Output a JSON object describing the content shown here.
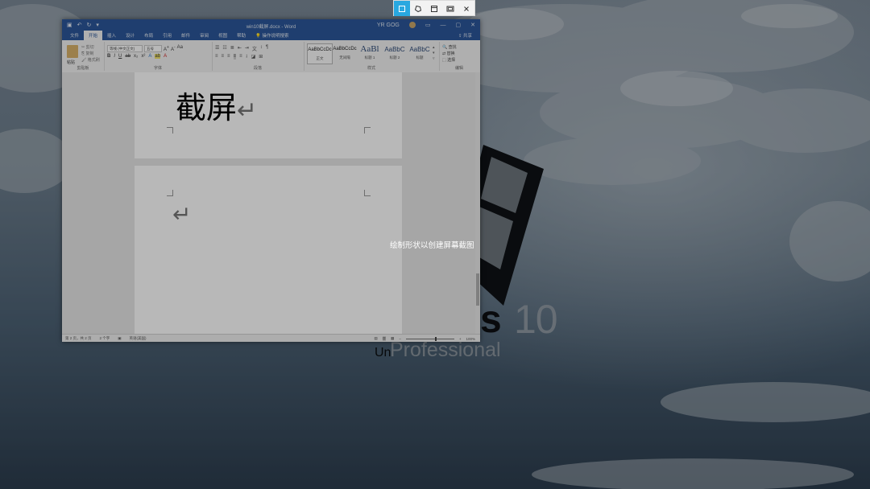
{
  "snip_toolbar": {
    "buttons": [
      {
        "name": "rectangular-snip",
        "icon": "rectangle-snip-icon",
        "active": true
      },
      {
        "name": "freeform-snip",
        "icon": "freeform-snip-icon",
        "active": false
      },
      {
        "name": "window-snip",
        "icon": "window-snip-icon",
        "active": false
      },
      {
        "name": "fullscreen-snip",
        "icon": "fullscreen-snip-icon",
        "active": false
      },
      {
        "name": "close",
        "icon": "close-icon",
        "active": false
      }
    ],
    "active_color": "#29a8e0"
  },
  "hint": "绘制形状以创建屏幕截图",
  "desktop": {
    "brand_number": "10",
    "brand_un": "Un",
    "brand_edition": "Professional"
  },
  "word": {
    "title": "win10截屏.docx  -  Word",
    "user": "YR GOG",
    "titlebar_color": "#2b579a",
    "tabs": [
      "文件",
      "开始",
      "插入",
      "设计",
      "布局",
      "引用",
      "邮件",
      "审阅",
      "视图",
      "帮助"
    ],
    "active_tab": "开始",
    "tell_me": "操作说明搜索",
    "share": "共享",
    "ribbon": {
      "clipboard": {
        "paste": "粘贴",
        "cut": "剪切",
        "copy": "复制",
        "format_painter": "格式刷",
        "label": "剪贴板"
      },
      "font": {
        "name": "等线 (中文正文)",
        "size": "五号",
        "label": "字体"
      },
      "paragraph": {
        "label": "段落"
      },
      "styles": {
        "items": [
          {
            "preview": "AaBbCcDc",
            "name": "正文"
          },
          {
            "preview": "AaBbCcDc",
            "name": "无间隔"
          },
          {
            "preview": "AaBl",
            "name": "标题 1"
          },
          {
            "preview": "AaBbC",
            "name": "标题 2"
          },
          {
            "preview": "AaBbC",
            "name": "标题"
          }
        ],
        "label": "样式"
      },
      "editing": {
        "find": "查找",
        "replace": "替换",
        "select": "选择",
        "label": "编辑"
      }
    },
    "document": {
      "heading": "截屏",
      "return_mark": "↵"
    },
    "status": {
      "page": "第 2 页，共 2 页",
      "words": "2 个字",
      "language": "英语(美国)",
      "zoom": "100%"
    }
  }
}
